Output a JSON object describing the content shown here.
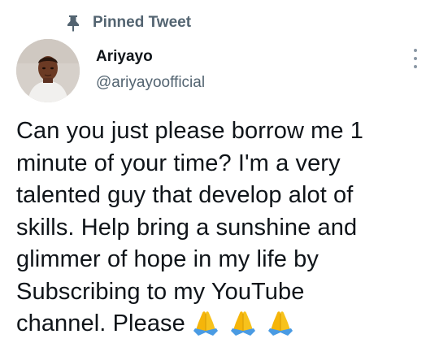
{
  "pinned": {
    "label": "Pinned Tweet",
    "icon": "pin-icon"
  },
  "author": {
    "display_name": "Ariyayo",
    "handle": "@ariyayoofficial"
  },
  "tweet": {
    "lines": [
      "Can you just please borrow me 1",
      "minute of your time? I'm a very",
      "talented guy that develop alot of",
      "skills. Help bring a sunshine and",
      "glimmer of hope in my life by",
      "Subscribing to my YouTube",
      "channel. Please"
    ],
    "emojis": [
      "🙏",
      "🙏",
      "🙏"
    ],
    "emoji_icon": "folded-hands-icon"
  },
  "colors": {
    "text": "#0f1419",
    "secondary": "#536471",
    "emoji": "#f5b50a",
    "emoji_cuff": "#4a9be3"
  }
}
